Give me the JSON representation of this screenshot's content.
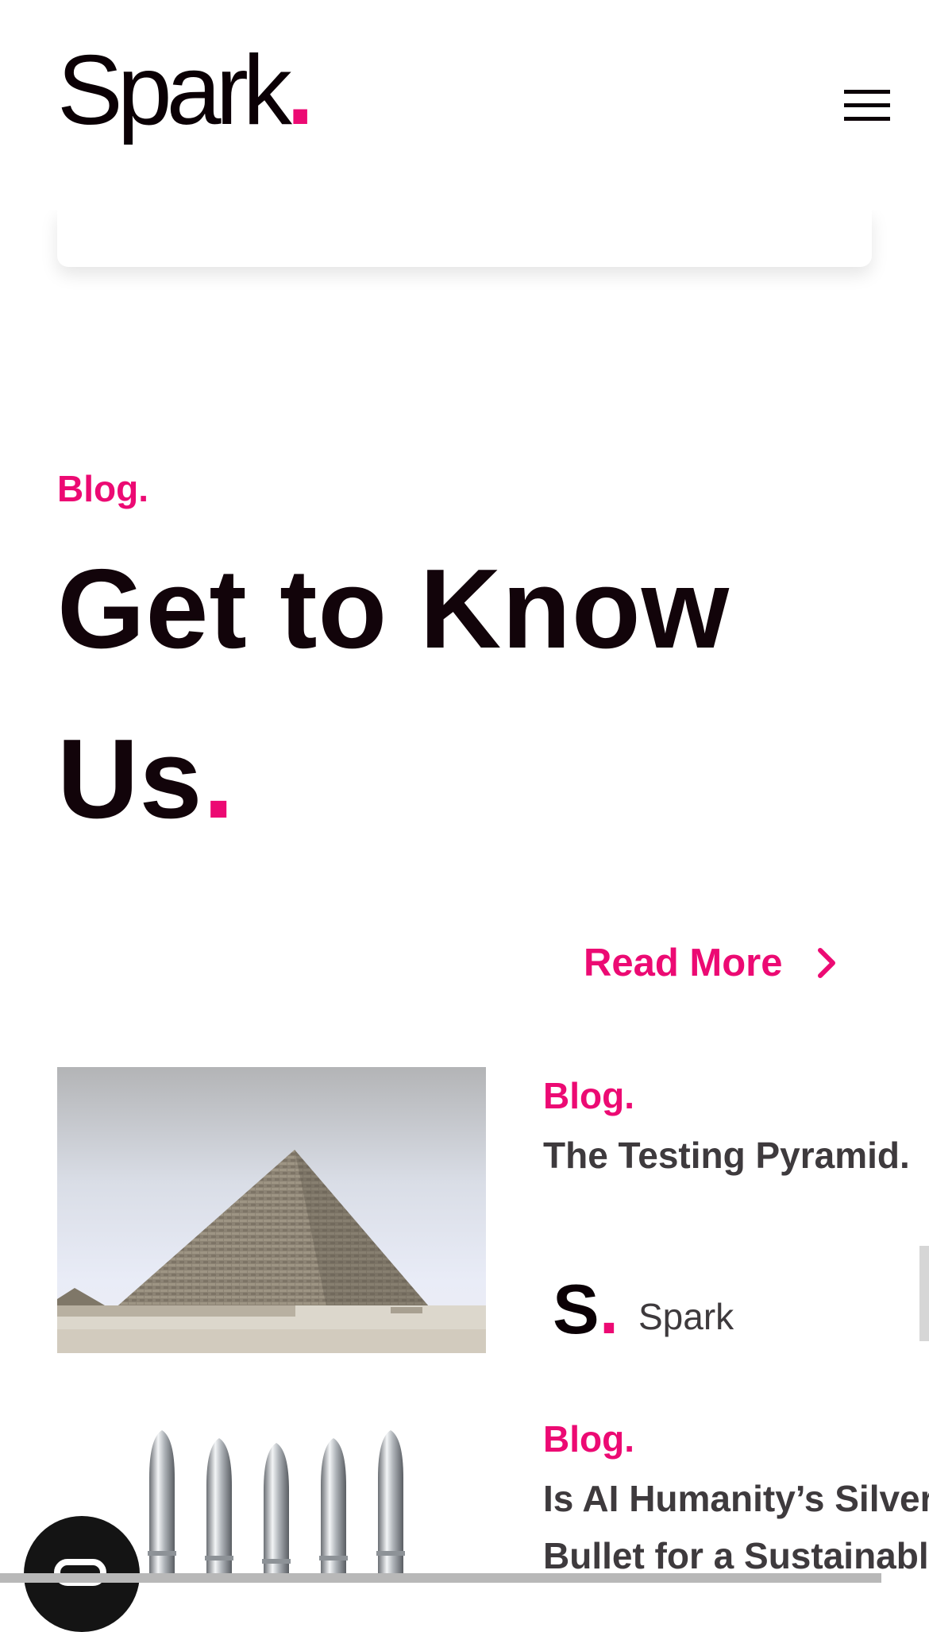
{
  "header": {
    "logo_text": "Spark",
    "logo_dot": ".",
    "menu_icon": "hamburger-menu-icon"
  },
  "blog_section": {
    "eyebrow": "Blog.",
    "headline": "Get to Know Us",
    "headline_dot": ".",
    "read_more": "Read More",
    "read_more_icon": "chevron-right-icon"
  },
  "posts": [
    {
      "image": "pyramid-image",
      "category": "Blog.",
      "title": "The Testing Pyramid.",
      "author_initial": "S",
      "author_dot": ".",
      "author_name": "Spark"
    },
    {
      "image": "silver-bullets-image",
      "category": "Blog.",
      "title_line1": "Is AI Humanity’s Silver",
      "title_line2": "Bullet for a Sustainable"
    }
  ],
  "colors": {
    "accent": "#ec0a73",
    "heading": "#12040a",
    "body_text": "#3e3a3d"
  }
}
